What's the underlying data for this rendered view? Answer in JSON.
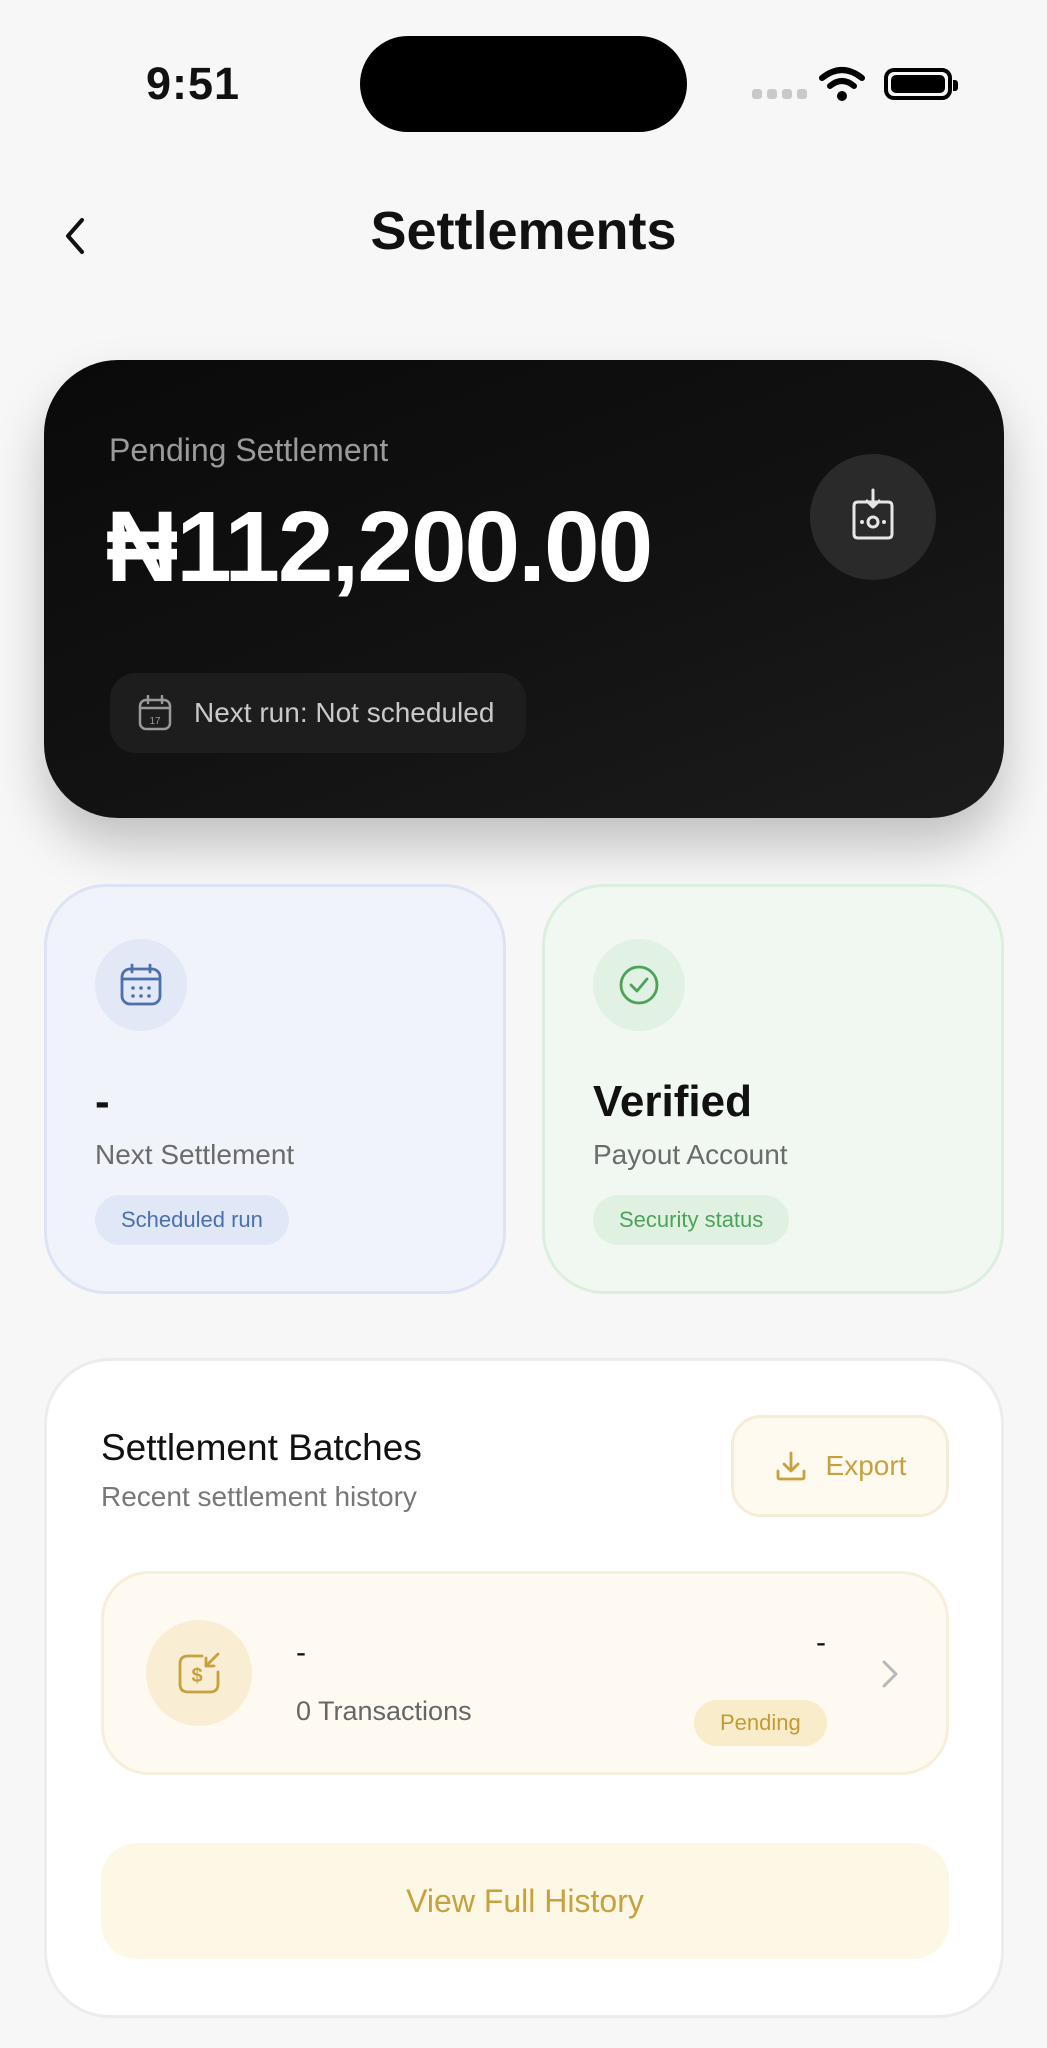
{
  "status_bar": {
    "time": "9:51"
  },
  "header": {
    "title": "Settlements"
  },
  "balance_card": {
    "label": "Pending Settlement",
    "amount": "₦112,200.00",
    "next_run": "Next run: Not scheduled",
    "calendar_day": "17"
  },
  "next_settlement_card": {
    "value": "-",
    "label": "Next Settlement",
    "badge": "Scheduled run"
  },
  "payout_card": {
    "value": "Verified",
    "label": "Payout Account",
    "badge": "Security status"
  },
  "batches": {
    "title": "Settlement Batches",
    "subtitle": "Recent settlement history",
    "export_label": "Export",
    "rows": [
      {
        "name": "-",
        "transactions": "0 Transactions",
        "amount": "-",
        "status": "Pending"
      }
    ],
    "view_history_label": "View Full History"
  },
  "colors": {
    "accent_gold": "#c6a13d",
    "card_dark": "#0a0a0a",
    "blue_tint": "#4c6fad",
    "green_tint": "#4da25a"
  },
  "icons": {
    "back": "chevron-left-icon",
    "balance": "wallet-download-icon",
    "next_run": "calendar-icon",
    "next_settlement": "calendar-grid-icon",
    "payout": "check-circle-icon",
    "export": "download-icon",
    "batch": "dollar-in-icon",
    "row_arrow": "chevron-right-icon"
  }
}
